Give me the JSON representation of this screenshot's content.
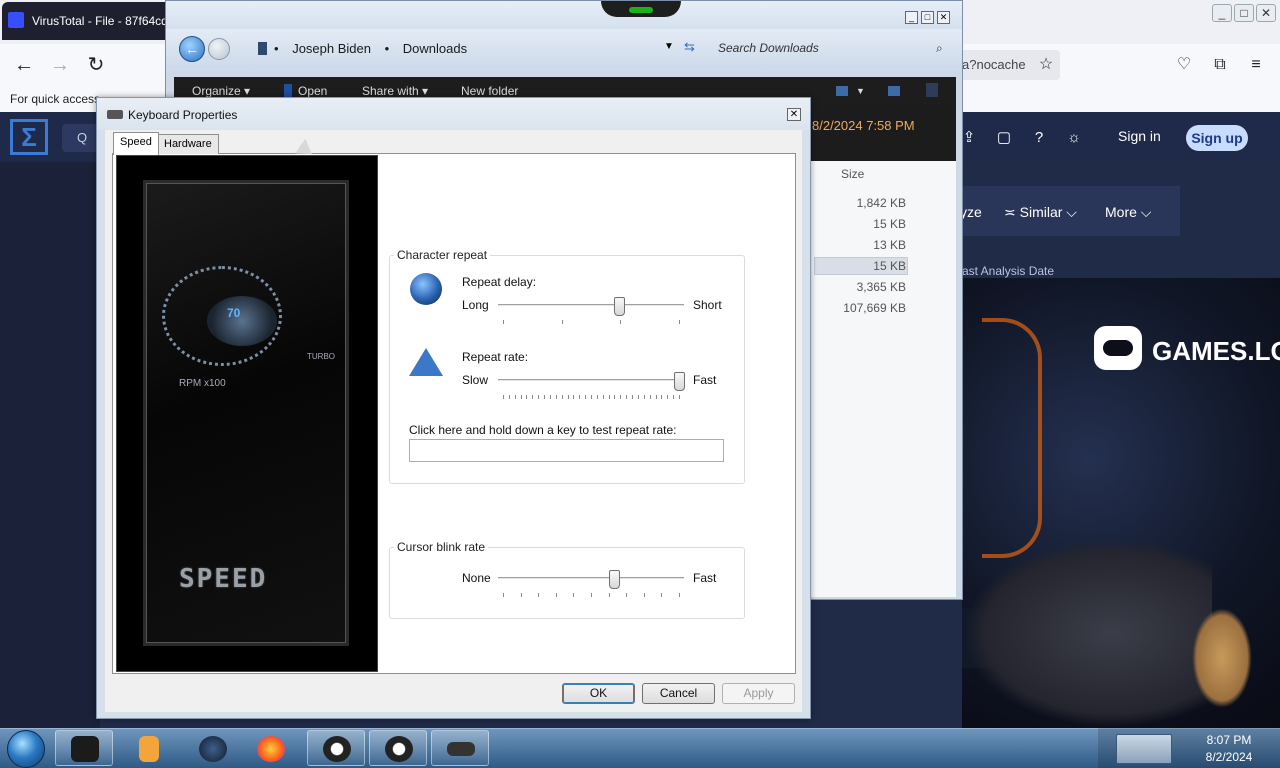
{
  "browser": {
    "tab_title": "VirusTotal - File - 87f64cd",
    "url_fragment": "a?nocache",
    "bookmarks_text": "For quick access",
    "nav": {
      "back": "←",
      "forward": "→",
      "reload": "↻"
    },
    "toolbar_icons": [
      "star-icon",
      "pocket-icon",
      "extensions-icon",
      "menu-icon"
    ],
    "window_controls": {
      "minimize": "_",
      "maximize": "□",
      "close": "✕"
    }
  },
  "virustotal": {
    "search_glyph": "Q",
    "signin": "Sign in",
    "signup": "Sign up",
    "subnav": {
      "analyze": "yze",
      "similar": "≍ Similar ⌵",
      "more": "More ⌵"
    },
    "last_analysis": "ast Analysis Date",
    "games_brand": "GAMES.LO"
  },
  "explorer": {
    "breadcrumb": [
      "Joseph Biden",
      "Downloads"
    ],
    "search_placeholder": "Search Downloads",
    "commands": [
      "Organize ▾",
      "Open",
      "Share with ▾",
      "New folder"
    ],
    "date_text": "8/2/2024 7:58 PM",
    "size_header": "Size",
    "sizes": [
      "1,842 KB",
      "15 KB",
      "13 KB",
      "15 KB",
      "3,365 KB",
      "107,669 KB"
    ],
    "selected_row": 3
  },
  "dialog": {
    "title": "Keyboard Properties",
    "close": "✕",
    "tabs": [
      "Speed",
      "Hardware"
    ],
    "active_tab": "Speed",
    "art": {
      "gauge_value": "70",
      "rpm_label": "RPM x100",
      "turbo_label": "TURBO",
      "word": "SPEED"
    },
    "character_repeat": {
      "label": "Character repeat",
      "repeat_delay": {
        "label": "Repeat delay:",
        "min": "Long",
        "max": "Short",
        "value": 0.66
      },
      "repeat_rate": {
        "label": "Repeat rate:",
        "min": "Slow",
        "max": "Fast",
        "value": 1.0
      },
      "test_label": "Click here and hold down a key to test repeat rate:",
      "test_value": ""
    },
    "cursor_blink": {
      "label": "Cursor blink rate",
      "min": "None",
      "max": "Fast",
      "value": 0.63
    },
    "buttons": {
      "ok": "OK",
      "cancel": "Cancel",
      "apply": "Apply"
    }
  },
  "taskbar": {
    "time": "8:07 PM",
    "date": "8/2/2024",
    "apps": [
      "explorer-window-icon",
      "media-player-icon",
      "globe-icon",
      "firefox-icon",
      "among-us-icon",
      "among-us-icon",
      "keyboard-icon"
    ]
  },
  "colors": {
    "vt_header": "#1f2a4a",
    "taskbar": "#2e5a86",
    "explorer_date": "#f0a860",
    "signup_button": "#c7dcff"
  }
}
